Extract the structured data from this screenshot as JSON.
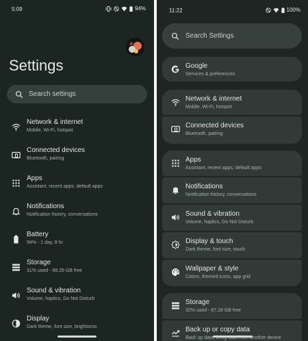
{
  "left_phone": {
    "status": {
      "time": "5:09",
      "battery": "94%"
    },
    "title": "Settings",
    "search_placeholder": "Search settings",
    "items": [
      {
        "title": "Network & internet",
        "subtitle": "Mobile, Wi-Fi, hotspot",
        "icon": "wifi-icon"
      },
      {
        "title": "Connected devices",
        "subtitle": "Bluetooth, pairing",
        "icon": "connected-devices-icon"
      },
      {
        "title": "Apps",
        "subtitle": "Assistant, recent apps, default apps",
        "icon": "apps-grid-icon"
      },
      {
        "title": "Notifications",
        "subtitle": "Notification history, conversations",
        "icon": "bell-icon"
      },
      {
        "title": "Battery",
        "subtitle": "94% - 1 day, 8 hr",
        "icon": "battery-icon"
      },
      {
        "title": "Storage",
        "subtitle": "31% used - 88.26 GB free",
        "icon": "storage-icon"
      },
      {
        "title": "Sound & vibration",
        "subtitle": "Volume, haptics, Do Not Disturb",
        "icon": "speaker-icon"
      },
      {
        "title": "Display",
        "subtitle": "Dark theme, font size, brightness",
        "icon": "display-icon"
      }
    ]
  },
  "right_phone": {
    "status": {
      "time": "11:22",
      "battery": "100%"
    },
    "search_placeholder": "Search Settings",
    "items": [
      {
        "title": "Google",
        "subtitle": "Services & preferences",
        "icon": "google-icon"
      },
      {
        "title": "Network & internet",
        "subtitle": "Mobile, Wi-Fi, hotspot",
        "icon": "wifi-icon"
      },
      {
        "title": "Connected devices",
        "subtitle": "Bluetooth, pairing",
        "icon": "connected-devices-icon"
      },
      {
        "title": "Apps",
        "subtitle": "Assistant, recent apps, default apps",
        "icon": "apps-grid-icon"
      },
      {
        "title": "Notifications",
        "subtitle": "Notification history, conversations",
        "icon": "bell-icon"
      },
      {
        "title": "Sound & vibration",
        "subtitle": "Volume, haptics, Do Not Disturb",
        "icon": "speaker-icon"
      },
      {
        "title": "Display & touch",
        "subtitle": "Dark theme, font size, touch",
        "icon": "display-icon"
      },
      {
        "title": "Wallpaper & style",
        "subtitle": "Colors, themed icons, app grid",
        "icon": "palette-icon"
      },
      {
        "title": "Storage",
        "subtitle": "32% used - 87.28 GB free",
        "icon": "storage-icon"
      },
      {
        "title": "Back up or copy data",
        "subtitle": "Back up data, bring data from another device",
        "icon": "backup-icon"
      }
    ]
  },
  "colors": {
    "left_background": "#1b2522",
    "right_background": "#1e2523",
    "card": "#323a37",
    "search_bar": "#34403c"
  }
}
